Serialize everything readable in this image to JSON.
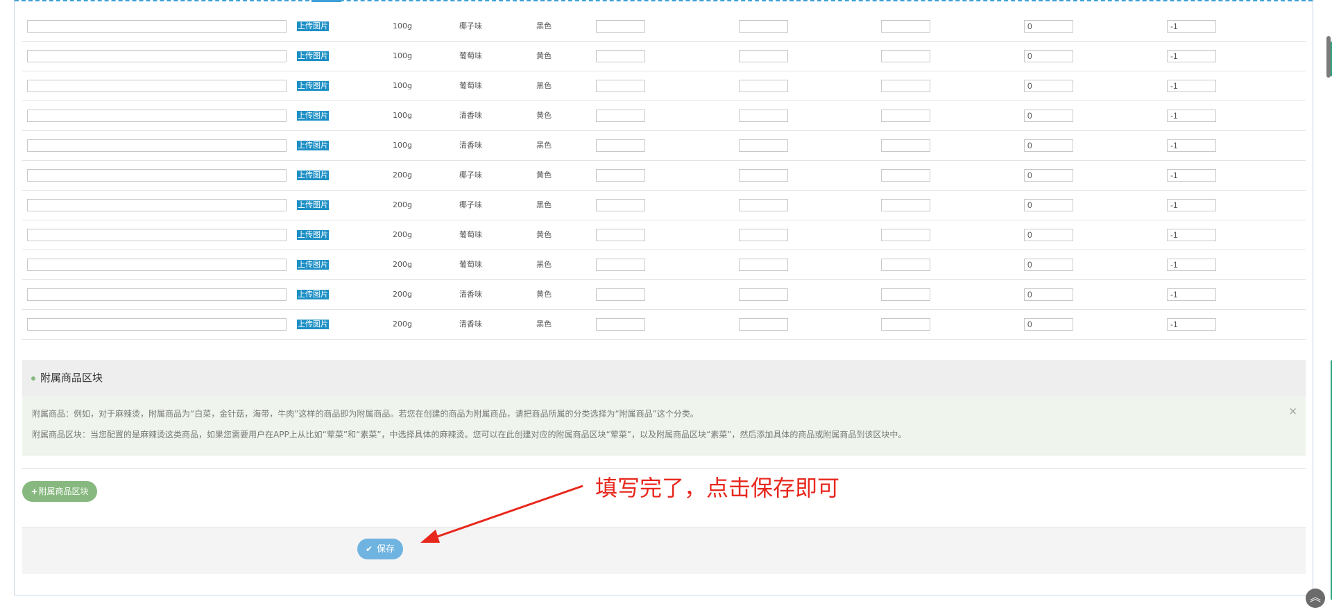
{
  "sku_table": {
    "upload_label": "上传图片",
    "rows": [
      {
        "weight": "100g",
        "flavor": "椰子味",
        "color": "黑色",
        "stock": "0",
        "limit": "-1"
      },
      {
        "weight": "100g",
        "flavor": "葡萄味",
        "color": "黄色",
        "stock": "0",
        "limit": "-1"
      },
      {
        "weight": "100g",
        "flavor": "葡萄味",
        "color": "黑色",
        "stock": "0",
        "limit": "-1"
      },
      {
        "weight": "100g",
        "flavor": "清香味",
        "color": "黄色",
        "stock": "0",
        "limit": "-1"
      },
      {
        "weight": "100g",
        "flavor": "清香味",
        "color": "黑色",
        "stock": "0",
        "limit": "-1"
      },
      {
        "weight": "200g",
        "flavor": "椰子味",
        "color": "黄色",
        "stock": "0",
        "limit": "-1"
      },
      {
        "weight": "200g",
        "flavor": "椰子味",
        "color": "黑色",
        "stock": "0",
        "limit": "-1"
      },
      {
        "weight": "200g",
        "flavor": "葡萄味",
        "color": "黄色",
        "stock": "0",
        "limit": "-1"
      },
      {
        "weight": "200g",
        "flavor": "葡萄味",
        "color": "黑色",
        "stock": "0",
        "limit": "-1"
      },
      {
        "weight": "200g",
        "flavor": "清香味",
        "color": "黄色",
        "stock": "0",
        "limit": "-1"
      },
      {
        "weight": "200g",
        "flavor": "清香味",
        "color": "黑色",
        "stock": "0",
        "limit": "-1"
      }
    ]
  },
  "addon_section": {
    "title": "附属商品区块",
    "info_line_1": "附属商品：例如，对于麻辣烫，附属商品为“白菜，金针菇，海带，牛肉”这样的商品即为附属商品。若您在创建的商品为附属商品，请把商品所属的分类选择为“附属商品”这个分类。",
    "info_line_2": "附属商品区块：当您配置的是麻辣烫这类商品，如果您需要用户在APP上从比如“荤菜”和“素菜”，中选择具体的麻辣烫。您可以在此创建对应的附属商品区块“荤菜”，以及附属商品区块“素菜”，然后添加具体的商品或附属商品到该区块中。",
    "close_symbol": "×",
    "add_button": "附属商品区块",
    "add_icon": "+"
  },
  "footer": {
    "save_button": "保存",
    "save_icon": "✔"
  },
  "annotation": {
    "text": "填写完了，点击保存即可"
  },
  "scroll_top_icon": "︽",
  "colors": {
    "upload_blue": "#1c8fc5",
    "green": "#87b87f",
    "save_blue": "#6fb3e0",
    "annotation_red": "#e8271c"
  }
}
